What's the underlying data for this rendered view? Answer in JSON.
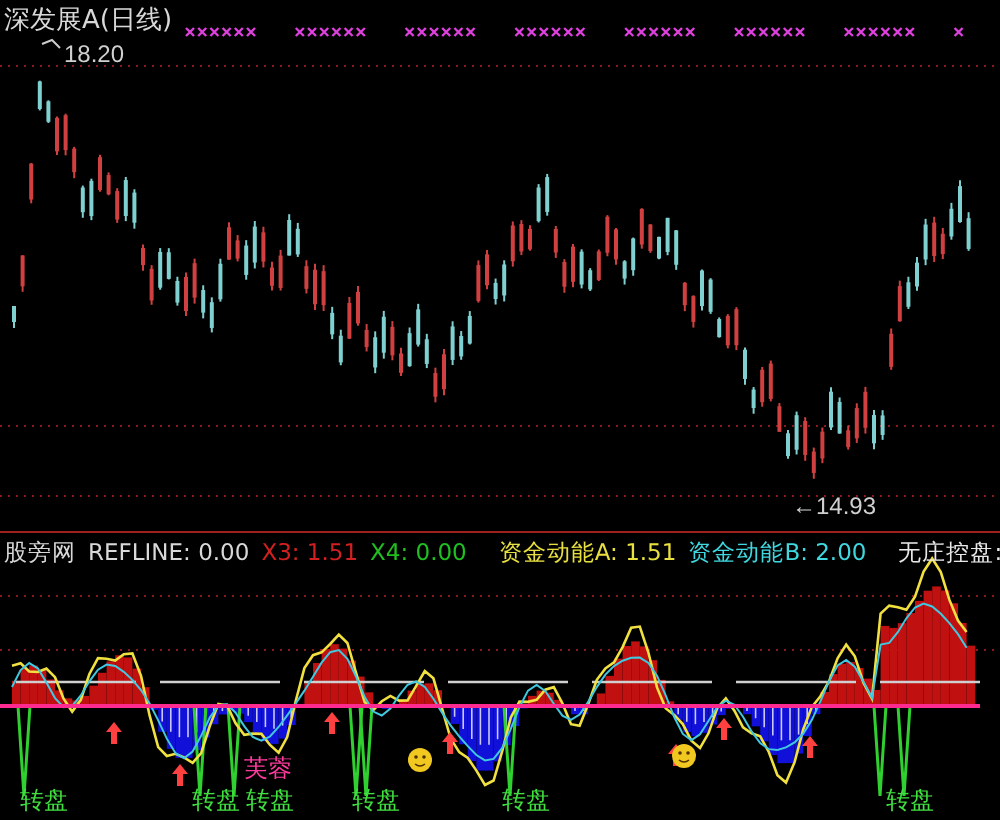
{
  "price_panel": {
    "title": "深发展A(日线)",
    "high_label": "18.20",
    "low_label": "←14.93"
  },
  "indicator_legend": [
    {
      "text": "股旁网",
      "color": "#d8d8d8"
    },
    {
      "text": "REFLINE: 0.00",
      "color": "#d8d8d8"
    },
    {
      "text": "X3: 1.51",
      "color": "#d02020"
    },
    {
      "text": "X4: 0.00",
      "color": "#20c020"
    },
    {
      "text": "资金动能A: 1.51",
      "color": "#e8e040"
    },
    {
      "text": "资金动能B: 2.00",
      "color": "#40d8e0"
    },
    {
      "text": "无庄控盘:",
      "color": "#e8e8e8"
    }
  ],
  "signal_labels": [
    {
      "text": "转盘",
      "color": "#40e040"
    },
    {
      "text": "转盘",
      "color": "#40e040"
    },
    {
      "text": "芙蓉",
      "color": "#ff3aa0"
    },
    {
      "text": "转盘",
      "color": "#40e040"
    },
    {
      "text": "转盘",
      "color": "#40e040"
    },
    {
      "text": "转盘",
      "color": "#40e040"
    },
    {
      "text": "转盘",
      "color": "#40e040"
    }
  ]
}
